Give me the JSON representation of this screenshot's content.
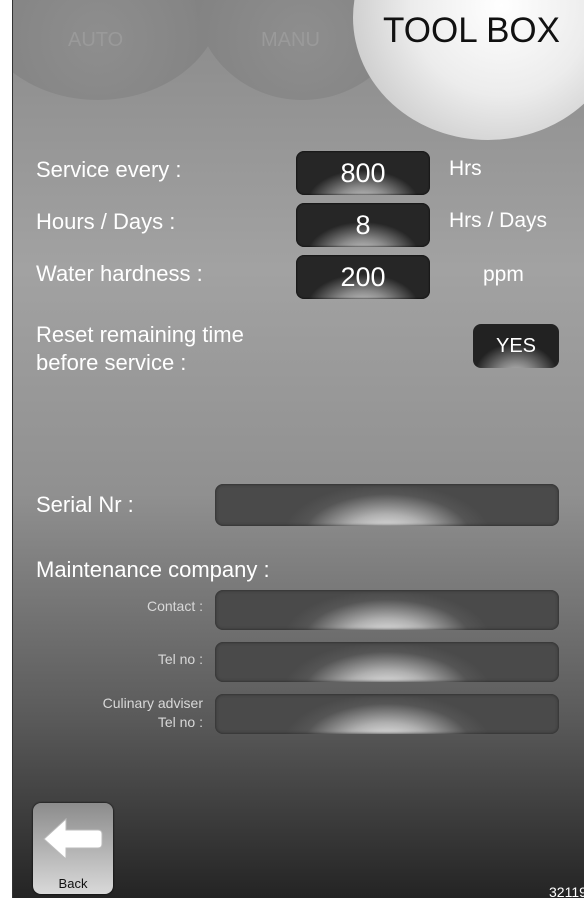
{
  "tabs": {
    "auto": "AUTO",
    "manu": "MANU",
    "toolbox": "TOOL BOX"
  },
  "settings": {
    "service_every": {
      "label": "Service every :",
      "value": "800",
      "unit": "Hrs"
    },
    "hours_days": {
      "label": "Hours / Days :",
      "value": "8",
      "unit": "Hrs / Days"
    },
    "water_hardness": {
      "label": "Water hardness :",
      "value": "200",
      "unit": "ppm"
    },
    "reset": {
      "label_line1": "Reset remaining time",
      "label_line2": "before service :",
      "button": "YES"
    }
  },
  "serial": {
    "label": "Serial Nr :",
    "value": ""
  },
  "maintenance": {
    "heading": "Maintenance company :",
    "contact": {
      "label": "Contact :",
      "value": ""
    },
    "tel": {
      "label": "Tel no :",
      "value": ""
    },
    "culinary": {
      "label_line1": "Culinary adviser",
      "label_line2": "Tel no :",
      "value": ""
    }
  },
  "back": {
    "label": "Back",
    "icon": "back-arrow-icon"
  },
  "image_ref": "32119",
  "colors": {
    "text": "#ffffff",
    "active_tab": "#f0f0f0",
    "inactive_tab": "#8a8a8a"
  }
}
